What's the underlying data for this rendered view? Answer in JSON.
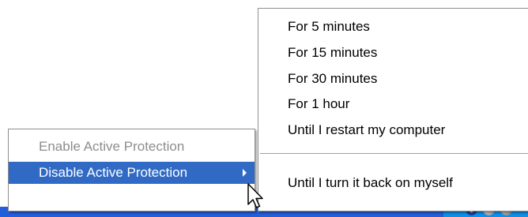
{
  "main_menu": {
    "items": [
      {
        "label": "Enable Active Protection",
        "state": "disabled"
      },
      {
        "label": "Disable Active Protection",
        "state": "selected",
        "has_submenu": true
      }
    ]
  },
  "submenu": {
    "items": [
      {
        "label": "For 5 minutes"
      },
      {
        "label": "For 15 minutes"
      },
      {
        "label": "For 30 minutes"
      },
      {
        "label": "For 1 hour"
      },
      {
        "label": "Until I restart my computer"
      },
      {
        "label": "Until I turn it back on myself"
      }
    ]
  },
  "tray": {
    "icons": [
      "antivirus-v-icon",
      "tray-app-icon",
      "tray-app-icon"
    ],
    "antivirus_glyph": "V"
  },
  "colors": {
    "selection": "#316ac5",
    "taskbar": "#245edb",
    "disabled_text": "#8d8d8d"
  }
}
